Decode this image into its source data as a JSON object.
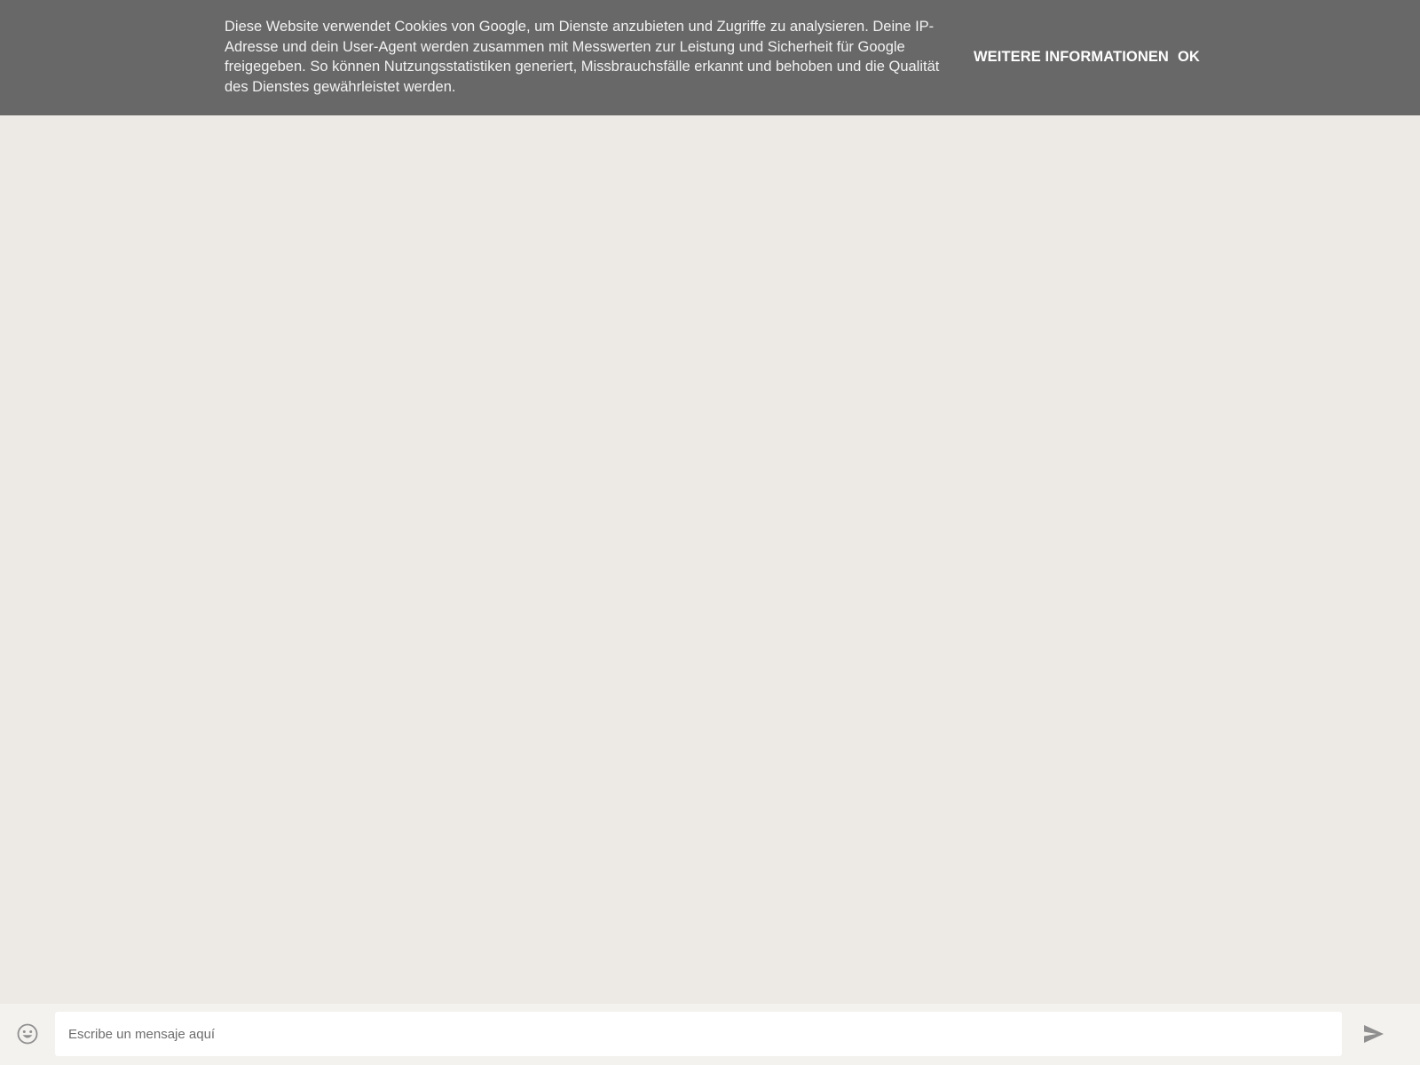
{
  "cookie_banner": {
    "message": "Diese Website verwendet Cookies von Google, um Dienste anzubieten und Zugriffe zu analysieren. Deine IP-Adresse und dein User-Agent werden zusammen mit Messwerten zur Leistung und Sicherheit für Google freigegeben. So können Nutzungsstatistiken generiert, Missbrauchsfälle erkannt und behoben und die Qualität des Dienstes gewährleistet werden.",
    "more_info_label": "WEITERE INFORMATIONEN",
    "ok_label": "OK",
    "background_color": "#686868"
  },
  "chat": {
    "background_color": "#ede9e4"
  },
  "composer": {
    "emoji_icon": "smiley-face-icon",
    "input_placeholder": "Escribe un mensaje aquí",
    "input_value": "",
    "send_icon": "send-arrow-icon"
  }
}
